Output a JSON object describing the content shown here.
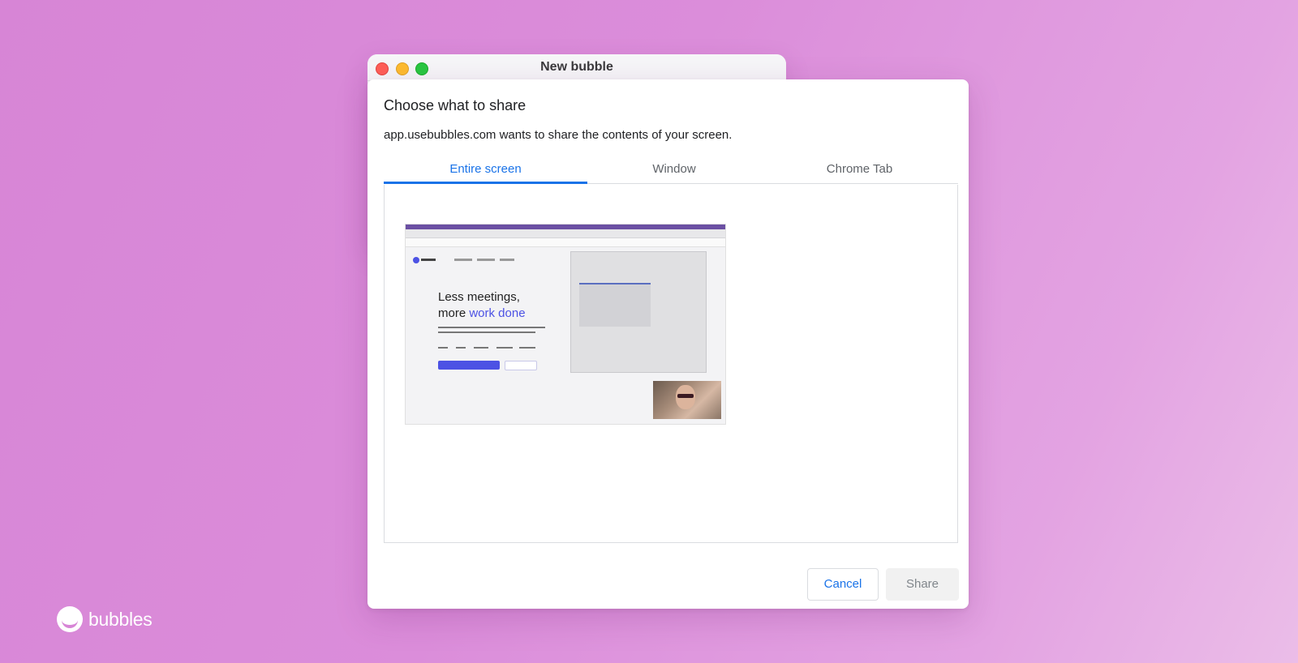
{
  "window": {
    "title": "New bubble"
  },
  "dialog": {
    "title": "Choose what to share",
    "subtitle": "app.usebubbles.com wants to share the contents of your screen.",
    "tabs": [
      {
        "label": "Entire screen",
        "active": true
      },
      {
        "label": "Window",
        "active": false
      },
      {
        "label": "Chrome Tab",
        "active": false
      }
    ],
    "preview": {
      "headline_line1": "Less meetings,",
      "headline_line2_plain": "more ",
      "headline_line2_accent": "work done"
    },
    "buttons": {
      "cancel": "Cancel",
      "share": "Share"
    }
  },
  "brand": {
    "name": "bubbles"
  },
  "colors": {
    "background": "#d785d6",
    "accent": "#1a73e8",
    "preview_accent": "#4c52e4"
  }
}
